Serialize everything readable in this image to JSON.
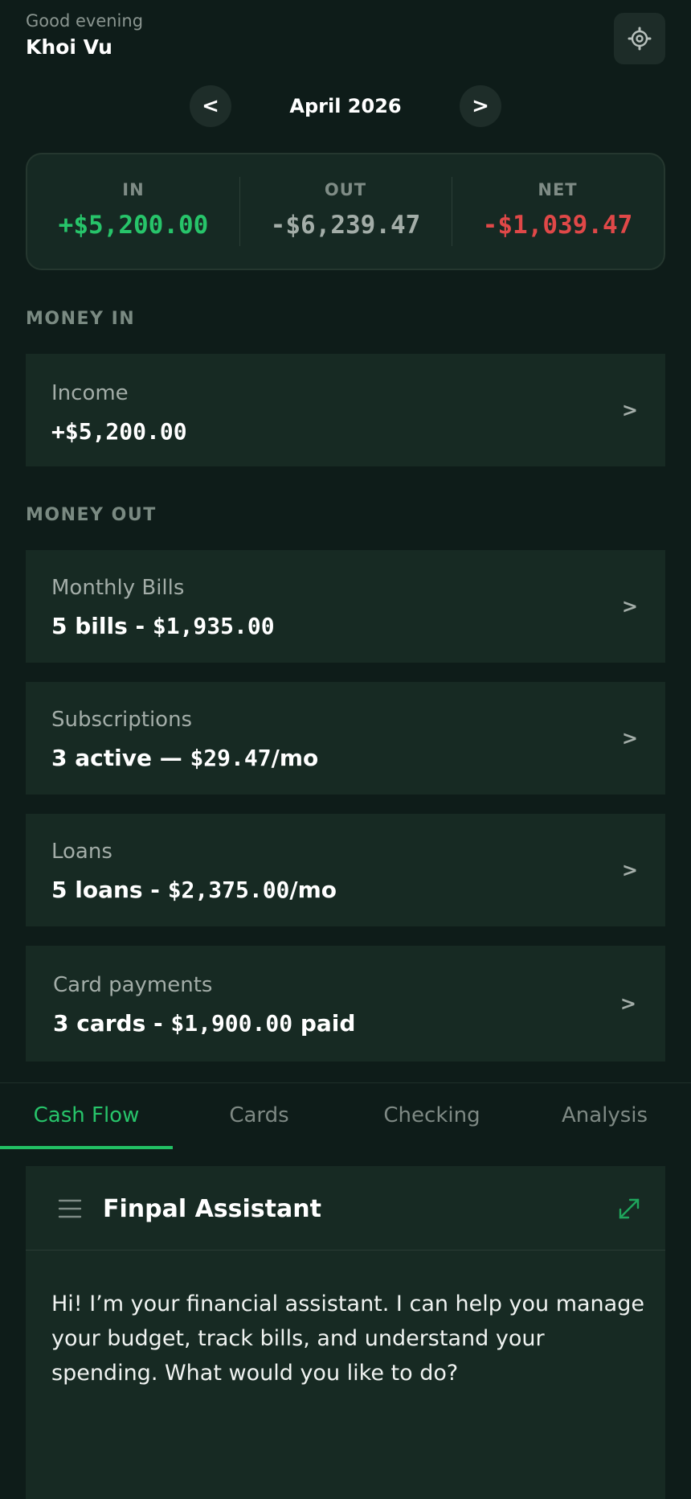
{
  "header": {
    "greeting": "Good evening",
    "username": "Khoi Vu"
  },
  "month_nav": {
    "prev": "<",
    "label": "April 2026",
    "next": ">"
  },
  "summary": {
    "in_label": "IN",
    "in_value": "+$5,200.00",
    "out_label": "OUT",
    "out_value": "-$6,239.47",
    "net_label": "NET",
    "net_value": "-$1,039.47"
  },
  "money_in": {
    "title": "MONEY IN",
    "income": {
      "title": "Income",
      "value": "+$5,200.00"
    }
  },
  "money_out": {
    "title": "MONEY OUT",
    "bills": {
      "title": "Monthly Bills",
      "count": "5 bills",
      "sep": " - ",
      "amount": "$1,935.00",
      "suffix": ""
    },
    "subscriptions": {
      "title": "Subscriptions",
      "count": "3 active",
      "sep": " — ",
      "amount": "$29.47",
      "suffix": "/mo"
    },
    "loans": {
      "title": "Loans",
      "count": "5 loans",
      "sep": " - ",
      "amount": "$2,375.00",
      "suffix": "/mo"
    },
    "cards": {
      "title": "Card payments",
      "count": "3 cards",
      "sep": " - ",
      "amount": "$1,900.00",
      "suffix": " paid"
    }
  },
  "chevron": ">",
  "tabs": [
    {
      "label": "Cash Flow",
      "active": true
    },
    {
      "label": "Cards",
      "active": false
    },
    {
      "label": "Checking",
      "active": false
    },
    {
      "label": "Analysis",
      "active": false
    }
  ],
  "assistant": {
    "title": "Finpal Assistant",
    "message": "Hi! I’m your financial assistant. I can help you manage your budget, track bills, and understand your spending. What would you like to do?"
  },
  "colors": {
    "background": "#0e1c19",
    "card": "#172a23",
    "positive": "#27c46a",
    "negative": "#e04848",
    "neutral": "#a3ada8"
  },
  "icons": {
    "settings": "gear-icon",
    "menu": "menu-icon",
    "expand": "expand-icon"
  }
}
